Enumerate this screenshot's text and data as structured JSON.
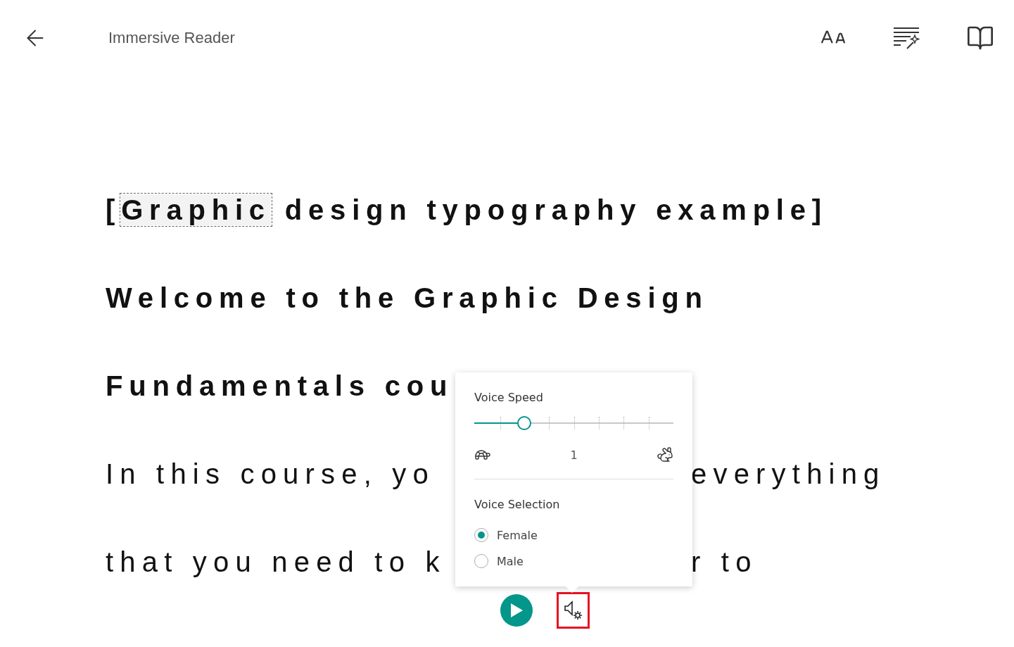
{
  "header": {
    "title": "Immersive Reader"
  },
  "reading": {
    "lines": [
      {
        "kind": "heading",
        "parts": [
          {
            "text": "[",
            "highlighted": false
          },
          {
            "text": "Graphic",
            "highlighted": true
          },
          {
            "text": " design typography example]",
            "highlighted": false
          }
        ]
      },
      {
        "kind": "heading",
        "parts": [
          {
            "text": "Welcome to the Graphic Design",
            "highlighted": false
          }
        ]
      },
      {
        "kind": "heading",
        "parts": [
          {
            "text": "Fundamentals cou",
            "highlighted": false
          }
        ]
      },
      {
        "kind": "body",
        "parts": [
          {
            "text": "In this course, yo",
            "highlighted": false
          }
        ],
        "right": "everything"
      },
      {
        "kind": "body",
        "parts": [
          {
            "text": "that you need to k",
            "highlighted": false
          }
        ],
        "right": "r to"
      }
    ]
  },
  "voice_popover": {
    "speed": {
      "label": "Voice Speed",
      "level": 0.25,
      "reading": "1"
    },
    "selection": {
      "label": "Voice Selection",
      "options": [
        {
          "label": "Female",
          "selected": true
        },
        {
          "label": "Male",
          "selected": false
        }
      ]
    }
  },
  "player": {
    "voice_settings": {
      "selected": true
    }
  }
}
